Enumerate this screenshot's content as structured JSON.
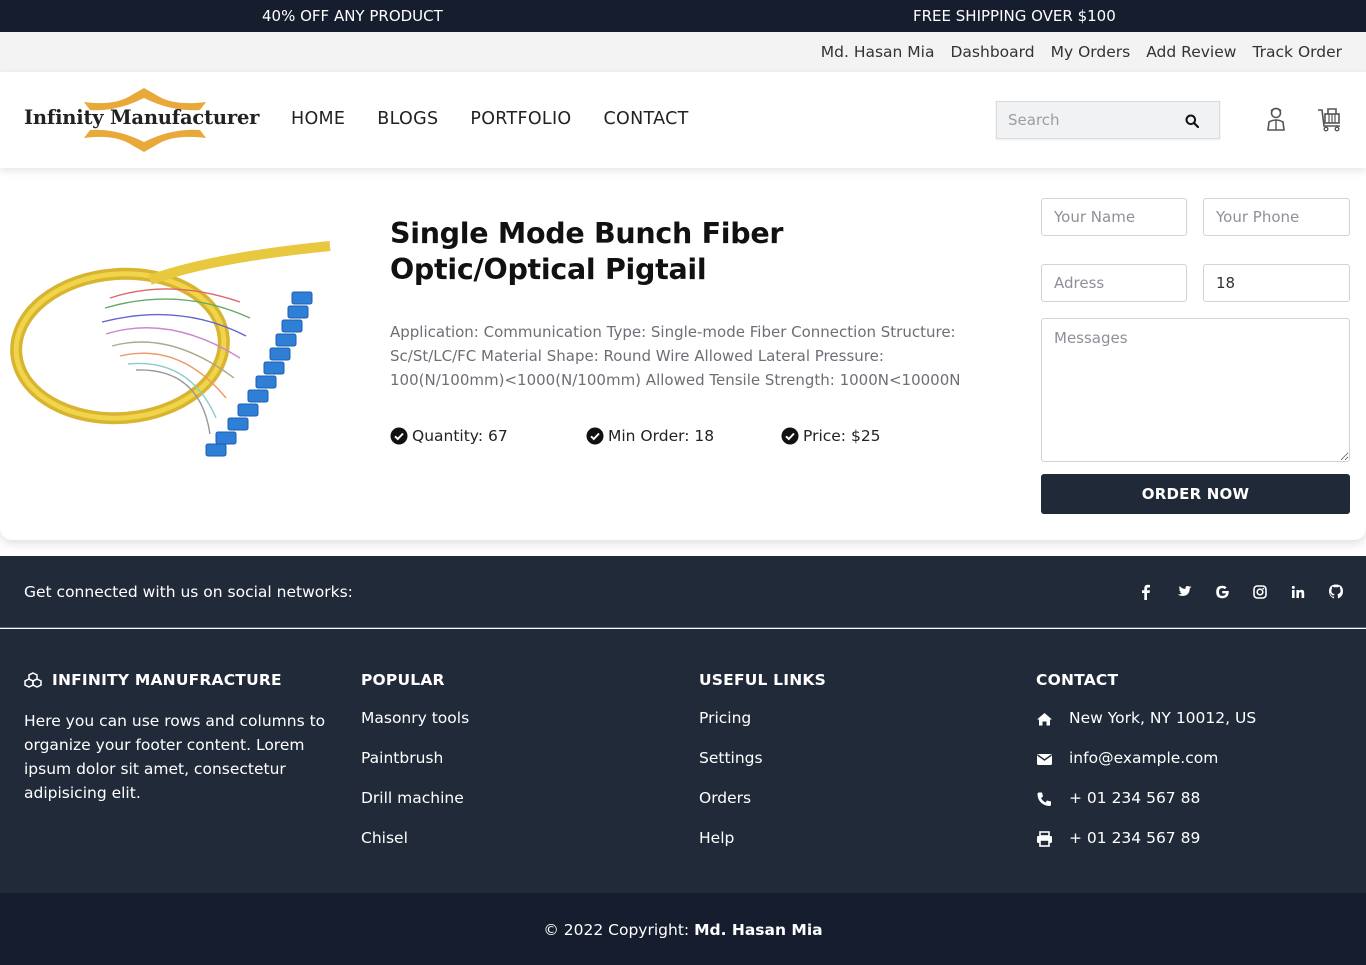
{
  "promo": {
    "left": "40% OFF ANY PRODUCT",
    "right": "FREE SHIPPING OVER $100"
  },
  "userbar": {
    "user_name": "Md. Hasan Mia",
    "dashboard": "Dashboard",
    "my_orders": "My Orders",
    "add_review": "Add Review",
    "track_order": "Track Order"
  },
  "header": {
    "logo_text": "Infinity Manufacturer",
    "nav": {
      "home": "HOME",
      "blogs": "BLOGS",
      "portfolio": "PORTFOLIO",
      "contact": "CONTACT"
    },
    "search_placeholder": "Search",
    "icons": [
      "search-icon",
      "user-icon",
      "cart-icon"
    ]
  },
  "product": {
    "title": "Single Mode Bunch Fiber Optic/Optical Pigtail",
    "description": "Application: Communication Type: Single-mode Fiber Connection Structure: Sc/St/LC/FC Material Shape: Round Wire Allowed Lateral Pressure: 100(N/100mm)<1000(N/100mm) Allowed Tensile Strength: 1000N<10000N",
    "quantity": "Quantity: 67",
    "min_order": "Min Order: 18",
    "price": "Price: $25"
  },
  "order_form": {
    "name_placeholder": "Your Name",
    "phone_placeholder": "Your Phone",
    "address_placeholder": "Adress",
    "quantity_value": "18",
    "messages_placeholder": "Messages",
    "submit_label": "ORDER NOW"
  },
  "social": {
    "text": "Get connected with us on social networks:",
    "icons": [
      "facebook-icon",
      "twitter-icon",
      "google-icon",
      "instagram-icon",
      "linkedin-icon",
      "github-icon"
    ]
  },
  "footer": {
    "brand_heading": "INFINITY MANUFRACTURE",
    "about": "Here you can use rows and columns to organize your footer content. Lorem ipsum dolor sit amet, consectetur adipisicing elit.",
    "popular_heading": "POPULAR",
    "popular": [
      "Masonry tools",
      "Paintbrush",
      "Drill machine",
      "Chisel"
    ],
    "useful_heading": "USEFUL LINKS",
    "useful": [
      "Pricing",
      "Settings",
      "Orders",
      "Help"
    ],
    "contact_heading": "CONTACT",
    "contact": {
      "address": "New York, NY 10012, US",
      "email": "info@example.com",
      "phone": "+ 01 234 567 88",
      "fax": "+ 01 234 567 89"
    }
  },
  "copyright": {
    "prefix": "© 2022 Copyright:",
    "owner": "Md. Hasan Mia"
  },
  "colors": {
    "dark_navy": "#151d2e",
    "footer_bg": "#212a39",
    "button_bg": "#1f2937",
    "logo_gold": "#e8a93a"
  }
}
